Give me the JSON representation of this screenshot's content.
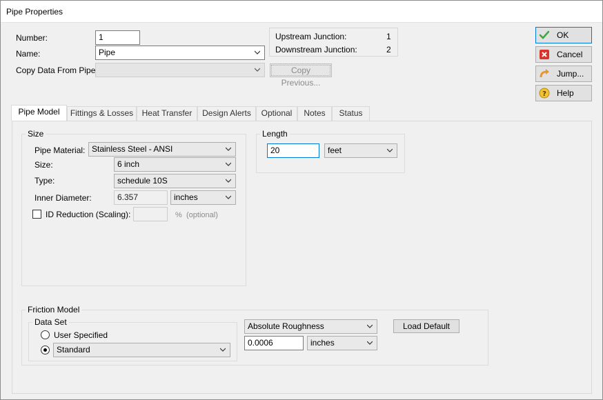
{
  "window": {
    "title": "Pipe Properties"
  },
  "form": {
    "number_label": "Number:",
    "number_value": "1",
    "name_label": "Name:",
    "name_value": "Pipe",
    "copy_label": "Copy Data From Pipe...",
    "copy_value": "",
    "copy_previous_label": "Copy Previous..."
  },
  "junctions": {
    "upstream_label": "Upstream Junction:",
    "upstream_value": "1",
    "downstream_label": "Downstream Junction:",
    "downstream_value": "2"
  },
  "side_buttons": {
    "ok": "OK",
    "cancel": "Cancel",
    "jump": "Jump...",
    "help": "Help"
  },
  "tabs": [
    {
      "label": "Pipe Model",
      "active": true
    },
    {
      "label": "Fittings & Losses"
    },
    {
      "label": "Heat Transfer"
    },
    {
      "label": "Design Alerts"
    },
    {
      "label": "Optional"
    },
    {
      "label": "Notes"
    },
    {
      "label": "Status"
    }
  ],
  "size": {
    "group_title": "Size",
    "material_label": "Pipe Material:",
    "material_value": "Stainless Steel - ANSI",
    "size_label": "Size:",
    "size_value": "6 inch",
    "type_label": "Type:",
    "type_value": "schedule 10S",
    "inner_diameter_label": "Inner Diameter:",
    "inner_diameter_value": "6.357",
    "inner_diameter_unit": "inches",
    "id_reduction_label": "ID Reduction (Scaling):",
    "id_reduction_value": "",
    "id_reduction_unit": "%",
    "id_reduction_hint": "(optional)"
  },
  "length": {
    "group_title": "Length",
    "value": "20",
    "unit": "feet"
  },
  "friction": {
    "group_title": "Friction Model",
    "dataset_title": "Data Set",
    "user_specified_label": "User Specified",
    "standard_label": "Standard",
    "standard_value": "Standard",
    "roughness_type": "Absolute Roughness",
    "roughness_value": "0.0006",
    "roughness_unit": "inches",
    "load_default_label": "Load Default"
  }
}
